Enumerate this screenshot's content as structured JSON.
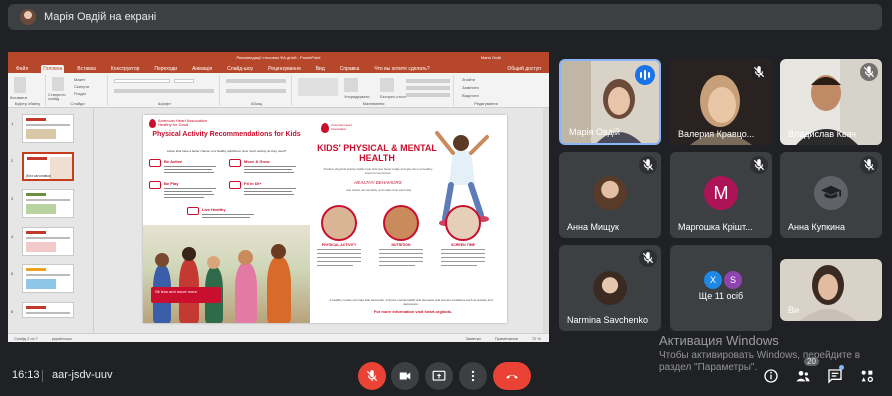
{
  "presenter_banner": {
    "title": "Марія Овдій на екрані"
  },
  "powerpoint": {
    "window_title": "Рекомендації стосовно ФА дітей - PowerPoint",
    "user": "Maria Ovdii",
    "tabs": [
      "Файл",
      "Головна",
      "Вставка",
      "Конструктор",
      "Переходи",
      "Анімація",
      "Слайд-шоу",
      "Рецензування",
      "Вид",
      "Справка",
      "Что вы хотите сделать?"
    ],
    "share": "Общий доступ",
    "ribbon_groups": [
      "Буфер обміну",
      "Слайди",
      "Шрифт",
      "Абзац",
      "Малювання",
      "Редагування"
    ],
    "ribbon_buttons": [
      "Вставити",
      "Створити слайд",
      "Макет",
      "Скинути",
      "Розділ",
      "Упорядкувати",
      "Експрес-стилі",
      "Знайти",
      "Замінити",
      "Виділити"
    ],
    "thumbs": [
      "1",
      "2",
      "3",
      "4",
      "5",
      "6"
    ],
    "thumb_caption": "(Без заголовка)",
    "status_left": "Слайд 2 из 7",
    "status_lang": "українська",
    "status_notes": "Заметки",
    "status_comments": "Примечания",
    "zoom": "72 %"
  },
  "slide": {
    "left_logo": "American Heart Association Healthy for Good",
    "left_title": "Physical Activity Recommendations for Kids",
    "left_sub": "Active kids have a better chance of a healthy adulthood. How much activity do they need?",
    "activities": [
      "Be Active",
      "Move & Grow",
      "Be Play",
      "Fit in 60+",
      "Live Healthy"
    ],
    "sit_less": "Sit less and move more.",
    "right_logo": "American Heart Association",
    "right_title": "KIDS' PHYSICAL & MENTAL HEALTH",
    "right_sub": "Positive physical activity habits help kids feel better today and give them a healthy boost for tomorrow.",
    "healthy": "HEALTHY BEHAVIORS",
    "healthy_sub": "Get social, act sensibly, and make time each day.",
    "circles": [
      "PHYSICAL ACTIVITY",
      "NUTRITION",
      "SCREEN TIME"
    ],
    "footer": "A healthy routine can help kids feel better, improve mental health and decrease and prevent conditions such as anxiety and depression.",
    "more": "For more information visit heart.org/kids."
  },
  "participants": [
    {
      "name": "Марія Овдій",
      "speaking": true
    },
    {
      "name": "Валерия Кравцо...",
      "muted": true
    },
    {
      "name": "Владислав Квач",
      "muted": true
    },
    {
      "name": "Анна Мищук",
      "muted": true
    },
    {
      "name": "Маргошка Крішт...",
      "muted": true,
      "letter": "M"
    },
    {
      "name": "Анна Купкина",
      "muted": true
    },
    {
      "name": "Narmina Savchenko",
      "muted": true
    },
    {
      "name": "Ще 11 осіб",
      "letters": [
        "X",
        "S"
      ]
    },
    {
      "name": "Ви"
    }
  ],
  "watermark": {
    "title": "Активация Windows",
    "text": "Чтобы активировать Windows, перейдите в раздел \"Параметры\"."
  },
  "bottom": {
    "time": "16:13",
    "code": "aar-jsdv-uuv",
    "people_badge": "20"
  }
}
